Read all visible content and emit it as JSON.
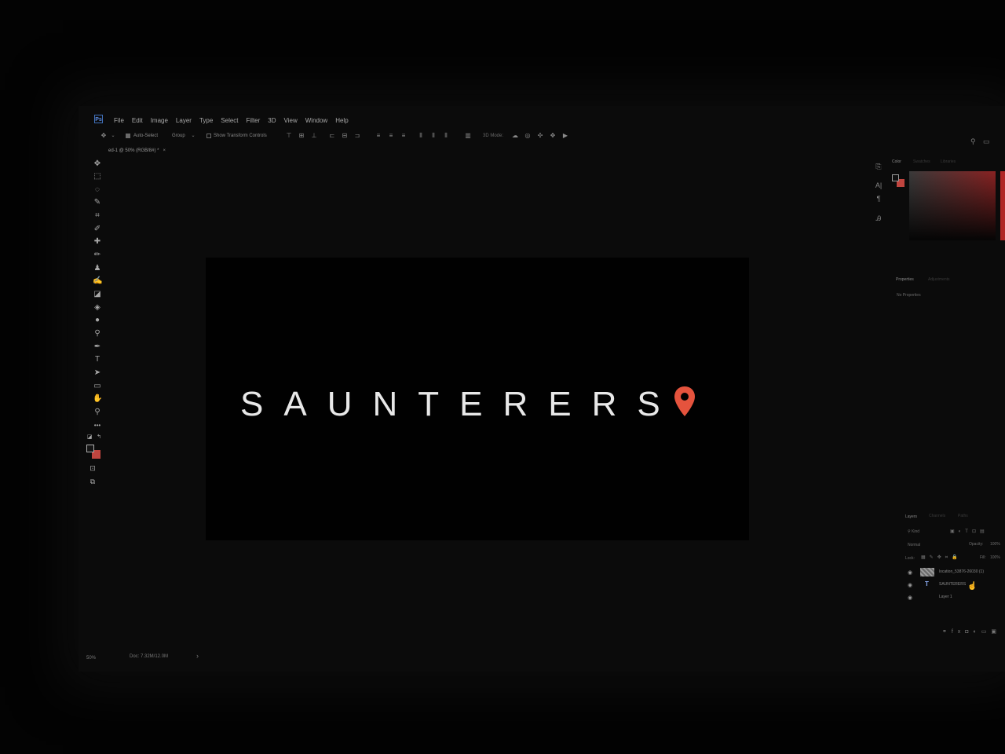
{
  "app": {
    "logo_text": "Ps"
  },
  "menu": [
    "File",
    "Edit",
    "Image",
    "Layer",
    "Type",
    "Select",
    "Filter",
    "3D",
    "View",
    "Window",
    "Help"
  ],
  "options_bar": {
    "auto_select_label": "Auto-Select",
    "auto_select_checked": true,
    "group_value": "Group",
    "show_transform_label": "Show Transform Controls",
    "show_transform_checked": false,
    "mode_3d_label": "3D Mode:"
  },
  "document": {
    "tab_title": "ed-1 @ 50% (RGB/8#) *",
    "tab_close": "×",
    "canvas_text": "SAUNTERERS",
    "pin_color": "#e5533d"
  },
  "tools": [
    "move-tool",
    "marquee-tool",
    "lasso-tool",
    "magic-wand-tool",
    "crop-tool",
    "eyedropper-tool",
    "healing-brush-tool",
    "brush-tool",
    "clone-stamp-tool",
    "history-brush-tool",
    "eraser-tool",
    "paint-bucket-tool",
    "blur-tool",
    "dodge-tool",
    "pen-tool",
    "type-tool",
    "path-selection-tool",
    "shape-tool",
    "hand-tool",
    "zoom-tool",
    "more-tools"
  ],
  "tool_glyphs": [
    "✥",
    "⬚",
    "◌",
    "✎",
    "⌗",
    "✐",
    "✚",
    "✏",
    "♟",
    "✍",
    "◪",
    "◈",
    "●",
    "⚲",
    "✒",
    "T",
    "➤",
    "▭",
    "✋",
    "⚲",
    "•••"
  ],
  "colors": {
    "foreground": "#151515",
    "background": "#c0453f"
  },
  "status": {
    "zoom": "50%",
    "doc_size": "Doc: 7.32M/12.0M",
    "arrow": "›"
  },
  "color_panel": {
    "tabs": [
      "Color",
      "Swatches",
      "Libraries"
    ]
  },
  "properties_panel": {
    "tabs": [
      "Properties",
      "Adjustments"
    ],
    "message": "No Properties"
  },
  "layers_panel": {
    "tabs": [
      "Layers",
      "Channels",
      "Paths"
    ],
    "filter_label": "Kind",
    "blend_mode": "Normal",
    "opacity_label": "Opacity:",
    "opacity_value": "100%",
    "lock_label": "Lock:",
    "fill_label": "Fill:",
    "fill_value": "100%",
    "layers": [
      {
        "name": "location_53876-26030 (1)",
        "kind": "image",
        "visible": true
      },
      {
        "name": "SAUNTERERS",
        "kind": "text",
        "visible": true
      },
      {
        "name": "Layer 1",
        "kind": "pixel",
        "visible": true
      }
    ]
  }
}
